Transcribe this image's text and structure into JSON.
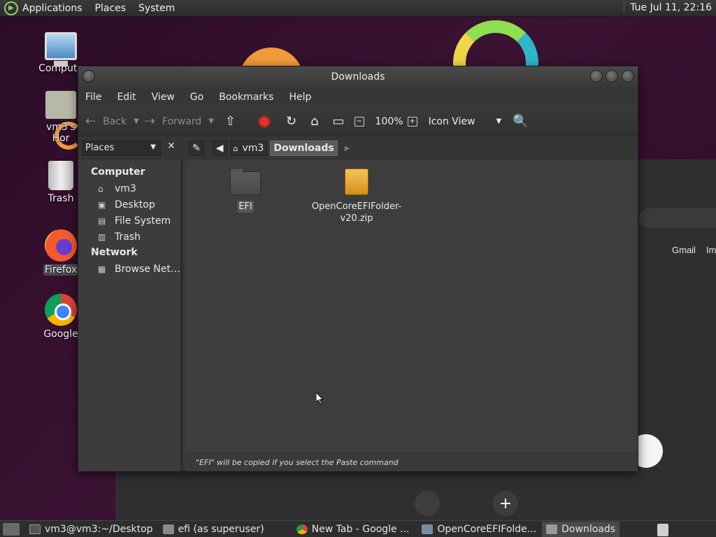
{
  "top_panel": {
    "menus": [
      "Applications",
      "Places",
      "System"
    ],
    "clock": "Tue Jul 11, 22:16"
  },
  "desktop": {
    "icons": [
      {
        "label": "Compute",
        "icon": "computer-icon"
      },
      {
        "label": "vm3's Hor",
        "icon": "home-folder-icon"
      },
      {
        "label": "Trash",
        "icon": "trash-icon"
      },
      {
        "label": "Firefox",
        "icon": "firefox-icon"
      },
      {
        "label": "Google",
        "icon": "chrome-icon"
      }
    ]
  },
  "background_window": {
    "gmail": "Gmail",
    "images": "Im"
  },
  "file_manager": {
    "title": "Downloads",
    "menu": [
      "File",
      "Edit",
      "View",
      "Go",
      "Bookmarks",
      "Help"
    ],
    "toolbar": {
      "back": "Back",
      "forward": "Forward",
      "zoom": "100%",
      "view_mode": "Icon View"
    },
    "places_selector": "Places",
    "breadcrumbs": [
      "vm3",
      "Downloads"
    ],
    "sidebar": {
      "computer_heading": "Computer",
      "computer_items": [
        {
          "label": "vm3",
          "icon": "home-icon"
        },
        {
          "label": "Desktop",
          "icon": "desktop-folder-icon"
        },
        {
          "label": "File System",
          "icon": "drive-icon"
        },
        {
          "label": "Trash",
          "icon": "trash-icon"
        }
      ],
      "network_heading": "Network",
      "network_items": [
        {
          "label": "Browse Net…",
          "icon": "network-icon"
        }
      ]
    },
    "files": [
      {
        "name": "EFI",
        "type": "folder"
      },
      {
        "name_line1": "OpenCoreEFIFolder-",
        "name_line2": "v20.zip",
        "type": "zip"
      }
    ],
    "status": "\"EFI\" will be copied if you select the Paste command"
  },
  "taskbar": {
    "tasks": [
      {
        "label": "vm3@vm3:~/Desktop",
        "icon": "terminal-icon"
      },
      {
        "label": "efi (as superuser)",
        "icon": "folder-icon"
      },
      {
        "label": "New Tab - Google ...",
        "icon": "chrome-icon"
      },
      {
        "label": "OpenCoreEFIFolde...",
        "icon": "archive-manager-icon"
      },
      {
        "label": "Downloads",
        "icon": "folder-icon",
        "active": true
      }
    ]
  }
}
